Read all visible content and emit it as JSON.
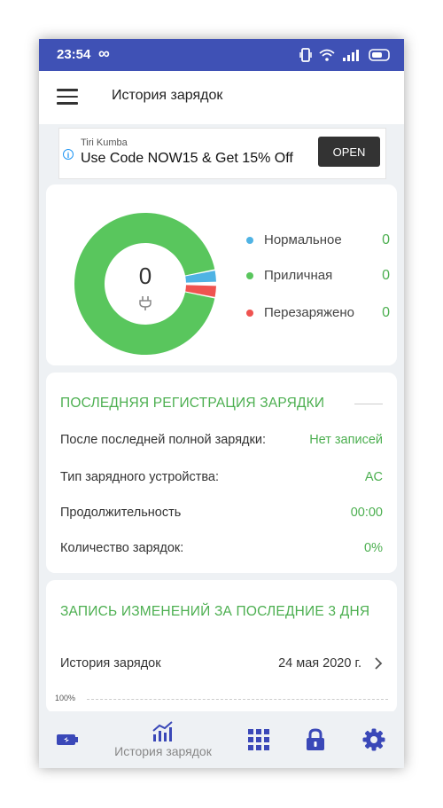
{
  "status_bar": {
    "time": "23:54",
    "link_glyph": "∞"
  },
  "app_bar": {
    "title": "История зарядок"
  },
  "ad": {
    "advertiser": "Tiri Kumba",
    "headline": "Use Code NOW15 & Get 15% Off",
    "cta": "OPEN",
    "info_glyph": "i"
  },
  "donut": {
    "center_value": "0",
    "segments": [
      {
        "name": "normal",
        "color": "#4fb3e4",
        "fraction": 0.025
      },
      {
        "name": "good",
        "color": "#59c65d",
        "fraction": 0.95
      },
      {
        "name": "overcharged",
        "color": "#ef5350",
        "fraction": 0.025
      }
    ],
    "legend": [
      {
        "label": "Нормальное",
        "value": "0",
        "color": "#4fb3e4"
      },
      {
        "label": "Приличная",
        "value": "0",
        "color": "#59c65d"
      },
      {
        "label": "Перезаряжено",
        "value": "0",
        "color": "#ef5350"
      }
    ]
  },
  "last_charge": {
    "title": "ПОСЛЕДНЯЯ РЕГИСТРАЦИЯ ЗАРЯДКИ",
    "rows": [
      {
        "label": "После последней полной зарядки:",
        "value": "Нет записей"
      },
      {
        "label": "Тип зарядного устройства:",
        "value": "AC"
      },
      {
        "label": "Продолжительность",
        "value": "00:00"
      },
      {
        "label": "Количество зарядок:",
        "value": "0%"
      }
    ]
  },
  "changes": {
    "title": "ЗАПИСЬ ИЗМЕНЕНИЙ ЗА ПОСЛЕДНИЕ 3 ДНЯ",
    "history_label": "История зарядок",
    "history_date": "24 мая 2020 г.",
    "chart_top_label": "100%"
  },
  "bottom_nav": {
    "items": [
      {
        "name": "battery"
      },
      {
        "name": "history",
        "label": "История зарядок"
      },
      {
        "name": "apps"
      },
      {
        "name": "lock"
      },
      {
        "name": "settings"
      }
    ]
  },
  "colors": {
    "accent": "#4caf50",
    "primary": "#3f51b5",
    "nav_icon": "#3a48b8"
  }
}
